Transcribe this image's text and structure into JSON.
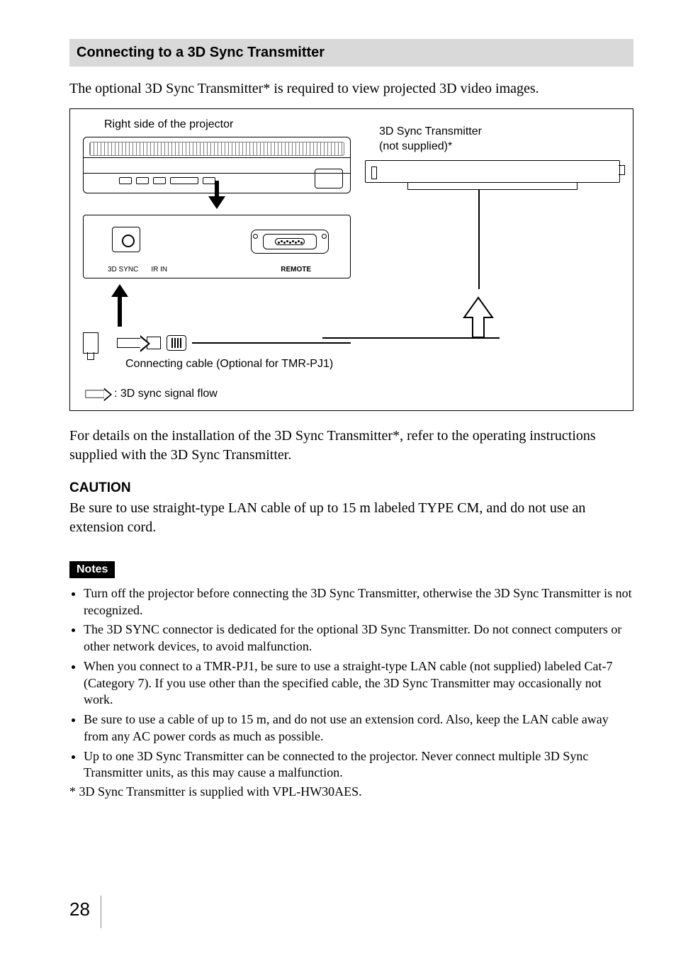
{
  "section_title": "Connecting to a 3D Sync Transmitter",
  "intro": "The optional 3D Sync Transmitter* is required to view projected 3D video images.",
  "diagram": {
    "left_title": "Right side of the projector",
    "port_labels": {
      "sync": "3D SYNC",
      "ir": "IR IN",
      "remote": "REMOTE"
    },
    "cable_caption": "Connecting cable (Optional for TMR-PJ1)",
    "legend": ": 3D sync signal flow",
    "right_title_line1": "3D Sync Transmitter",
    "right_title_line2": "(not supplied)*"
  },
  "after_diagram": "For details on the installation of the 3D Sync Transmitter*, refer to the operating instructions supplied with the 3D Sync Transmitter.",
  "caution_heading": "CAUTION",
  "caution_body": "Be sure to use straight-type LAN cable of up to 15 m labeled TYPE CM, and do not use an extension cord.",
  "notes_label": "Notes",
  "notes": [
    "Turn off the projector before connecting the 3D Sync Transmitter, otherwise the 3D Sync Transmitter is not recognized.",
    "The 3D SYNC connector is dedicated for the optional 3D Sync Transmitter. Do not connect computers or other network devices, to avoid malfunction.",
    "When you connect to a TMR-PJ1, be sure to use a straight-type LAN cable (not supplied) labeled Cat-7 (Category 7). If you use other than the specified cable, the 3D Sync Transmitter may occasionally not work.",
    "Be sure to use a cable of up to 15 m, and do not use an extension cord. Also, keep the LAN cable away from any AC power cords as much as possible.",
    "Up to one 3D Sync Transmitter can be connected to the projector. Never connect multiple 3D Sync Transmitter units, as this may cause a malfunction."
  ],
  "footnote": "* 3D Sync Transmitter is supplied with VPL-HW30AES.",
  "page_number": "28"
}
